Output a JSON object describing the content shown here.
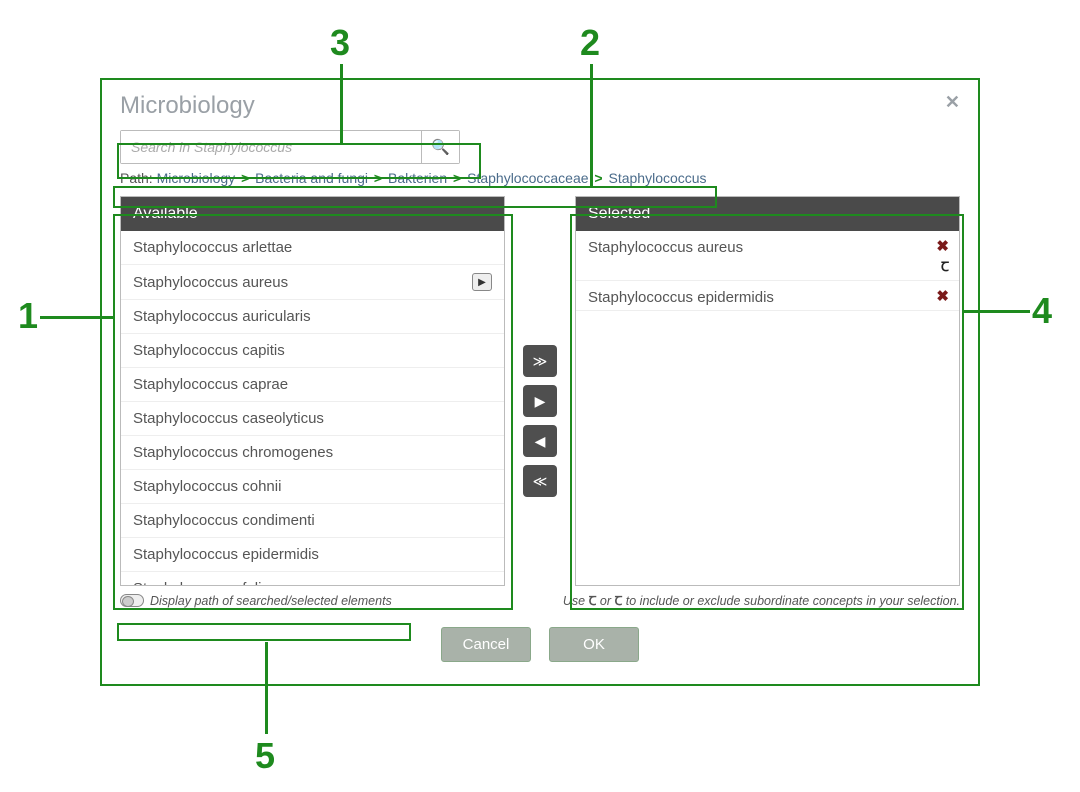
{
  "callouts": {
    "c1": "1",
    "c2": "2",
    "c3": "3",
    "c4": "4",
    "c5": "5"
  },
  "dialog": {
    "title": "Microbiology",
    "search_placeholder": "Search in Staphylococcus",
    "breadcrumb": {
      "label": "Path:",
      "items": [
        "Microbiology",
        "Bacteria and fungi",
        "Bakterien",
        "Staphylococcaceae",
        "Staphylococcus"
      ]
    },
    "available": {
      "header": "Available",
      "items": [
        {
          "name": "Staphylococcus arlettae",
          "drill": false
        },
        {
          "name": "Staphylococcus aureus",
          "drill": true
        },
        {
          "name": "Staphylococcus auricularis",
          "drill": false
        },
        {
          "name": "Staphylococcus capitis",
          "drill": false
        },
        {
          "name": "Staphylococcus caprae",
          "drill": false
        },
        {
          "name": "Staphylococcus caseolyticus",
          "drill": false
        },
        {
          "name": "Staphylococcus chromogenes",
          "drill": false
        },
        {
          "name": "Staphylococcus cohnii",
          "drill": false
        },
        {
          "name": "Staphylococcus condimenti",
          "drill": false
        },
        {
          "name": "Staphylococcus epidermidis",
          "drill": false
        },
        {
          "name": "Staphylococcus felis",
          "drill": false
        }
      ]
    },
    "selected": {
      "header": "Selected",
      "items": [
        {
          "name": "Staphylococcus aureus",
          "show_sub_icon": true
        },
        {
          "name": "Staphylococcus epidermidis",
          "show_sub_icon": false
        }
      ]
    },
    "toggle_label": "Display path of searched/selected elements",
    "hint_prefix": "Use ",
    "hint_mid": " or ",
    "hint_suffix": " to include or exclude subordinate concepts in your selection.",
    "buttons": {
      "cancel": "Cancel",
      "ok": "OK"
    },
    "icons": {
      "sub_include": "Ꞇ",
      "sub_exclude": "Ꞇ"
    }
  }
}
